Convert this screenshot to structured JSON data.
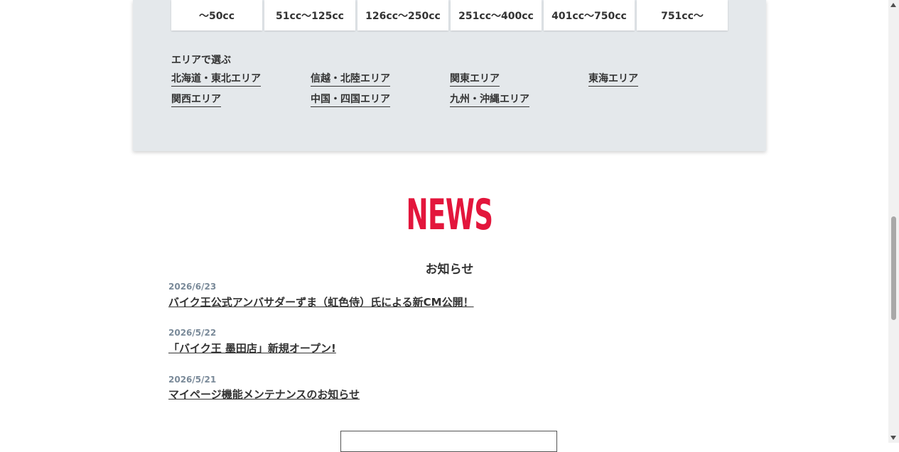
{
  "displacement_filter": {
    "buttons": [
      "〜50cc",
      "51cc〜125cc",
      "126cc〜250cc",
      "251cc〜400cc",
      "401cc〜750cc",
      "751cc〜"
    ]
  },
  "area_filter": {
    "heading": "エリアで選ぶ",
    "links": [
      "北海道・東北エリア",
      "信越・北陸エリア",
      "関東エリア",
      "東海エリア",
      "関西エリア",
      "中国・四国エリア",
      "九州・沖縄エリア"
    ]
  },
  "news": {
    "title": "NEWS",
    "subtitle": "お知らせ",
    "items": [
      {
        "date": "2026/6/23",
        "title": "バイク王公式アンバサダーずま（虹色侍）氏による新CM公開！"
      },
      {
        "date": "2026/5/22",
        "title": "「バイク王 墨田店」新規オープン!"
      },
      {
        "date": "2026/5/21",
        "title": "マイページ機能メンテナンスのお知らせ"
      }
    ]
  }
}
